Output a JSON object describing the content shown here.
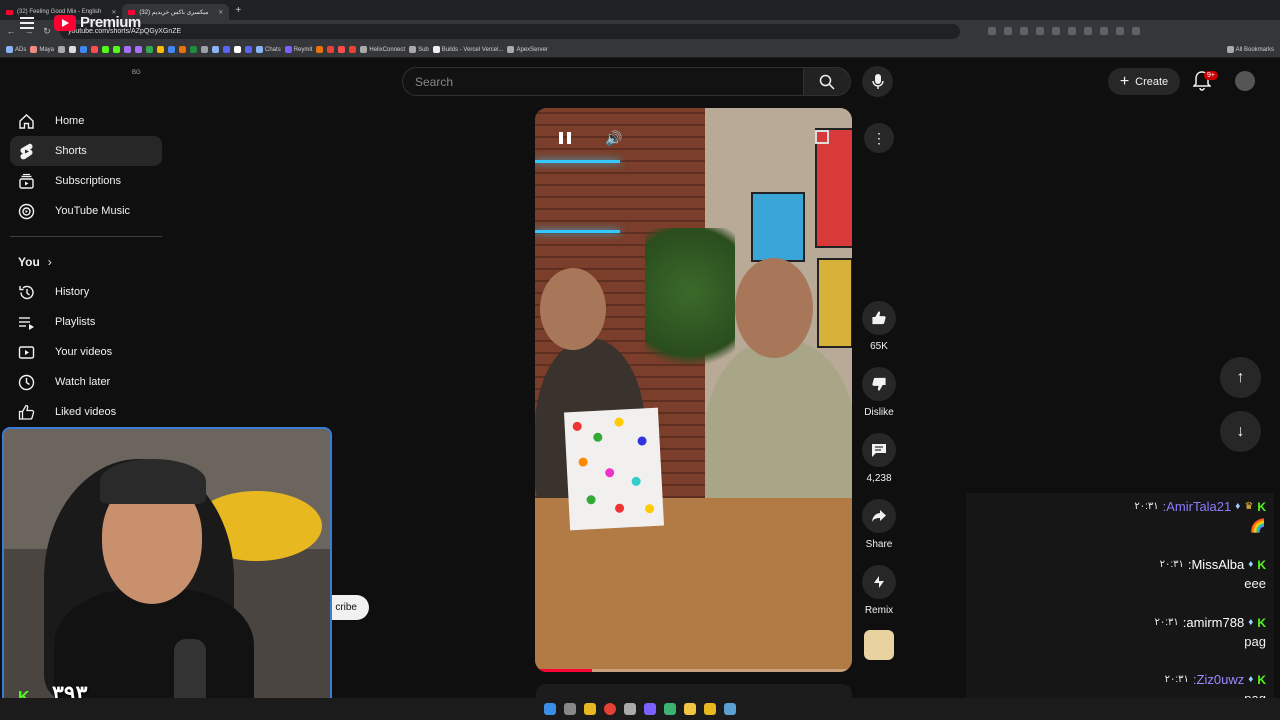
{
  "browser": {
    "tabs": [
      {
        "title": "(32) Feeling Good Mix - English"
      },
      {
        "title": "(32) میکسری باکس خریدیم"
      }
    ],
    "url": "youtube.com/shorts/AZpQGyXGnZE",
    "bookmarks": [
      "ADs",
      "Maya",
      "Chats",
      "Reymit",
      "HelixConnect",
      "Sub",
      "Builds - Vercel Vercel...",
      "ApexServer",
      "All Bookmarks"
    ]
  },
  "header": {
    "logo_text": "Premium",
    "region": "BG",
    "search_placeholder": "Search",
    "create_label": "Create",
    "notifications_badge": "9+"
  },
  "sidebar": {
    "items": [
      {
        "label": "Home",
        "icon": "home-icon"
      },
      {
        "label": "Shorts",
        "icon": "shorts-icon"
      },
      {
        "label": "Subscriptions",
        "icon": "subscriptions-icon"
      },
      {
        "label": "YouTube Music",
        "icon": "music-icon"
      }
    ],
    "you_label": "You",
    "you_items": [
      {
        "label": "History",
        "icon": "history-icon"
      },
      {
        "label": "Playlists",
        "icon": "playlists-icon"
      },
      {
        "label": "Your videos",
        "icon": "your-videos-icon"
      },
      {
        "label": "Watch later",
        "icon": "watch-later-icon"
      },
      {
        "label": "Liked videos",
        "icon": "liked-videos-icon"
      }
    ]
  },
  "short": {
    "progress_fraction": 0.18,
    "actions": [
      {
        "label": "65K",
        "icon": "like-icon"
      },
      {
        "label": "Dislike",
        "icon": "dislike-icon"
      },
      {
        "label": "4,238",
        "icon": "comment-icon"
      },
      {
        "label": "Share",
        "icon": "share-icon"
      },
      {
        "label": "Remix",
        "icon": "remix-icon"
      }
    ]
  },
  "subscribe_partial": "cribe",
  "webcam": {
    "counter": "۳۹۳"
  },
  "chat": {
    "messages": [
      {
        "time": "۲۰:۳۱",
        "user": ":AmirTala21",
        "text": "🌈",
        "user_color": "#8a7bff"
      },
      {
        "time": "۲۰:۳۱",
        "user": ":MissAlba",
        "text": "eee",
        "user_color": "#ffffff"
      },
      {
        "time": "۲۰:۳۱",
        "user": ":amirm788",
        "text": "pag",
        "user_color": "#ffffff"
      },
      {
        "time": "۲۰:۳۱",
        "user": ":Ziz0uwz",
        "text": "pag",
        "user_color": "#9a8cff"
      }
    ]
  },
  "colors": {
    "brand": "#ff0033",
    "kick_green": "#53fc18",
    "accent_blue": "#3ea6ff"
  }
}
